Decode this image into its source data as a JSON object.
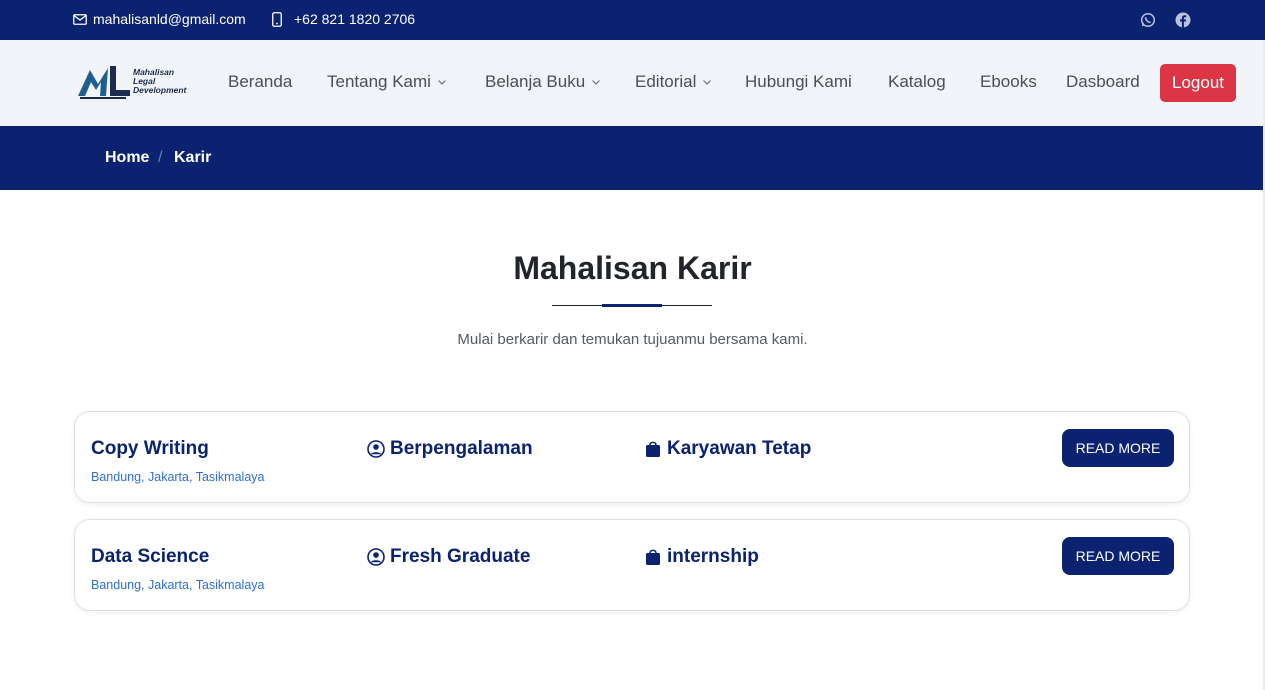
{
  "topbar": {
    "email": "mahalisanld@gmail.com",
    "phone": "+62 821 1820 2706",
    "icons": [
      "envelope-icon",
      "phone-icon",
      "whatsapp-icon",
      "facebook-icon"
    ]
  },
  "logo": {
    "line1": "Mahalisan",
    "line2": "Legal",
    "line3": "Development"
  },
  "nav": {
    "items": [
      {
        "label": "Beranda"
      },
      {
        "label": "Tentang Kami"
      },
      {
        "label": "Belanja Buku"
      },
      {
        "label": "Editorial"
      },
      {
        "label": "Hubungi Kami"
      },
      {
        "label": "Katalog"
      },
      {
        "label": "Ebooks"
      },
      {
        "label": "Dasboard"
      }
    ],
    "logout_label": "Logout"
  },
  "breadcrumb": {
    "home": "Home",
    "separator": "/",
    "current": "Karir"
  },
  "section": {
    "title": "Mahalisan Karir",
    "subtitle": "Mulai berkarir dan temukan tujuanmu bersama kami."
  },
  "jobs": [
    {
      "title": "Copy Writing",
      "locations": "Bandung, Jakarta, Tasikmalaya",
      "experience": "Berpengalaman",
      "type": "Karyawan Tetap",
      "button": "READ MORE"
    },
    {
      "title": "Data Science",
      "locations": "Bandung, Jakarta, Tasikmalaya",
      "experience": "Fresh Graduate",
      "type": "internship",
      "button": "READ MORE"
    }
  ],
  "colors": {
    "primary": "#0a2270",
    "danger": "#dc3545",
    "nav_bg": "#f1f4f8",
    "link": "#2f6fd6"
  }
}
